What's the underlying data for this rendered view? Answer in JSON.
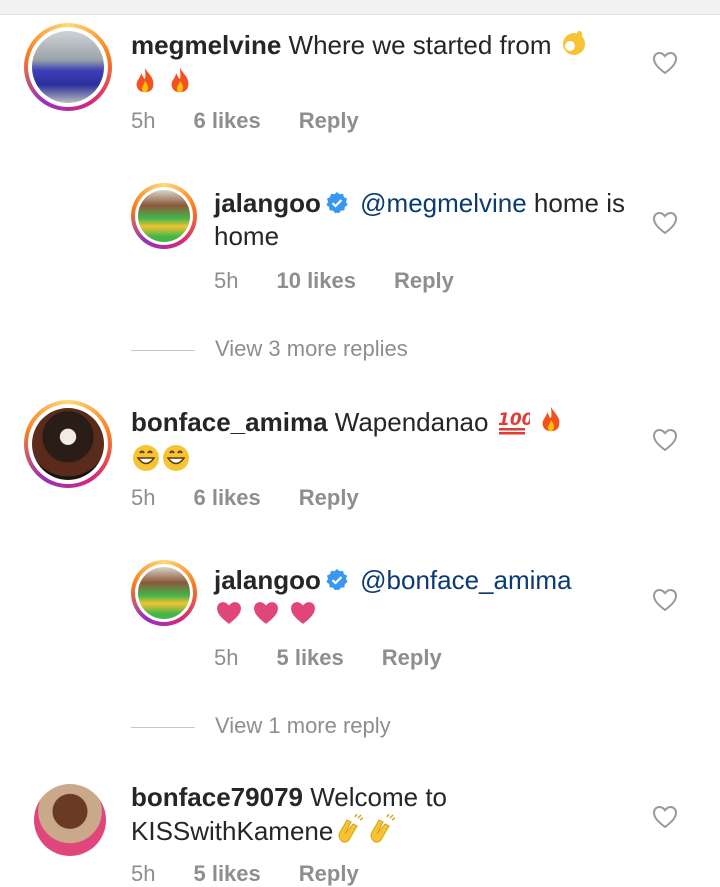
{
  "comments": [
    {
      "username": "megmelvine",
      "text": "Where we started from",
      "time": "5h",
      "likes": "6 likes",
      "reply": "Reply",
      "replies": [
        {
          "username": "jalangoo",
          "mention": "@megmelvine",
          "text": " home is home",
          "time": "5h",
          "likes": "10 likes",
          "reply": "Reply"
        }
      ],
      "view_more": "View 3 more replies"
    },
    {
      "username": "bonface_amima",
      "text": "Wapendanao",
      "time": "5h",
      "likes": "6 likes",
      "reply": "Reply",
      "replies": [
        {
          "username": "jalangoo",
          "mention": "@bonface_amima",
          "text": "",
          "time": "5h",
          "likes": "5 likes",
          "reply": "Reply"
        }
      ],
      "view_more": "View 1 more reply"
    },
    {
      "username": "bonface79079",
      "text": "Welcome to KISSwithKamene",
      "time": "5h",
      "likes": "5 likes",
      "reply": "Reply"
    }
  ],
  "icons": {
    "like": "heart-outline-icon",
    "verified": "verified-badge-icon",
    "emoji_ok": "ok-hand-emoji",
    "emoji_fire": "fire-emoji",
    "emoji_100": "hundred-points-emoji",
    "emoji_grin": "grinning-emoji",
    "emoji_heart": "pink-heart-emoji",
    "emoji_clap": "clapping-hands-emoji"
  },
  "colors": {
    "mention": "#0b3b73",
    "verified": "#3897f0",
    "meta": "#8e8e8e",
    "heart_emoji": "#e0457b"
  }
}
